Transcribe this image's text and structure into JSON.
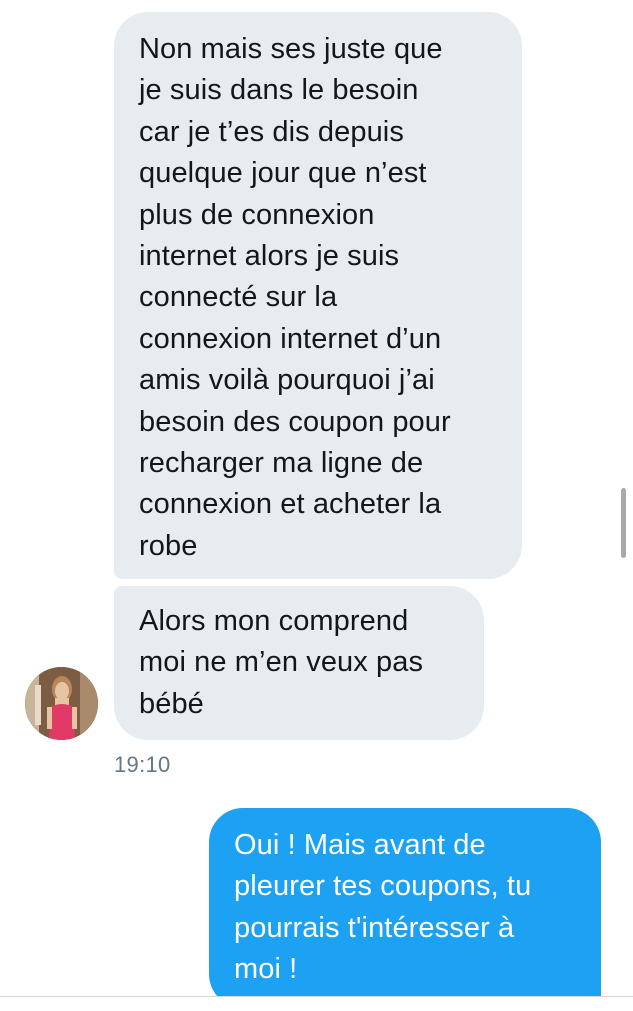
{
  "conversation": {
    "messages": [
      {
        "direction": "received",
        "text": "Non mais ses juste que\nje suis dans le besoin\ncar je t’es dis depuis\nquelque jour que n’est\nplus de connexion\ninternet alors je suis\nconnecté sur la\nconnexion internet d’un\namis voilà pourquoi j’ai\nbesoin des coupon pour\nrecharger ma ligne de\nconnexion et acheter la\nrobe"
      },
      {
        "direction": "received",
        "text": "Alors mon comprend\nmoi ne m’en veux pas\nbébé"
      },
      {
        "direction": "sent",
        "text": "Oui ! Mais avant de\npleurer tes coupons, tu\npourrais t'intéresser à\nmoi !"
      }
    ],
    "timestamp": "19:10"
  },
  "colors": {
    "received_bubble": "#e6ecf0",
    "sent_bubble": "#1da1f2",
    "timestamp_text": "#657786"
  },
  "icons": {
    "avatar": "contact-avatar-photo"
  }
}
